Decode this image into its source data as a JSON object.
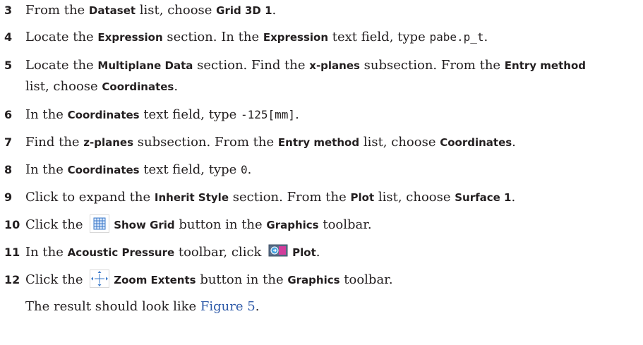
{
  "steps": [
    {
      "num": "3",
      "parts": [
        "From the ",
        "Dataset",
        " list, choose ",
        "Grid 3D 1",
        "."
      ]
    },
    {
      "num": "4",
      "parts": [
        "Locate the ",
        "Expression",
        " section. In the ",
        "Expression",
        " text field, type ",
        "pabe.p_t",
        "."
      ]
    },
    {
      "num": "5",
      "line1": [
        "Locate the ",
        "Multiplane Data",
        " section. Find the ",
        "x-planes",
        " subsection. From the ",
        "Entry method"
      ],
      "line2": [
        "list, choose ",
        "Coordinates",
        "."
      ]
    },
    {
      "num": "6",
      "parts": [
        "In the ",
        "Coordinates",
        " text field, type ",
        "-125[mm]",
        "."
      ]
    },
    {
      "num": "7",
      "parts": [
        "Find the ",
        "z-planes",
        " subsection. From the ",
        "Entry method",
        " list, choose ",
        "Coordinates",
        "."
      ]
    },
    {
      "num": "8",
      "parts": [
        "In the ",
        "Coordinates",
        " text field, type ",
        "0",
        "."
      ]
    },
    {
      "num": "9",
      "parts": [
        "Click to expand the ",
        "Inherit Style",
        " section. From the ",
        "Plot",
        " list, choose ",
        "Surface 1",
        "."
      ]
    },
    {
      "num": "10",
      "parts": [
        "Click the ",
        "Show Grid",
        " button in the ",
        "Graphics",
        " toolbar."
      ],
      "icon": "show-grid-icon"
    },
    {
      "num": "11",
      "parts": [
        "In the ",
        "Acoustic Pressure",
        " toolbar, click ",
        "Plot",
        "."
      ],
      "icon": "plot-icon"
    },
    {
      "num": "12",
      "parts": [
        "Click the ",
        "Zoom Extents",
        " button in the ",
        "Graphics",
        " toolbar."
      ],
      "icon": "zoom-extents-icon"
    }
  ],
  "result": {
    "text": "The result should look like ",
    "link": "Figure 5",
    "end": "."
  }
}
